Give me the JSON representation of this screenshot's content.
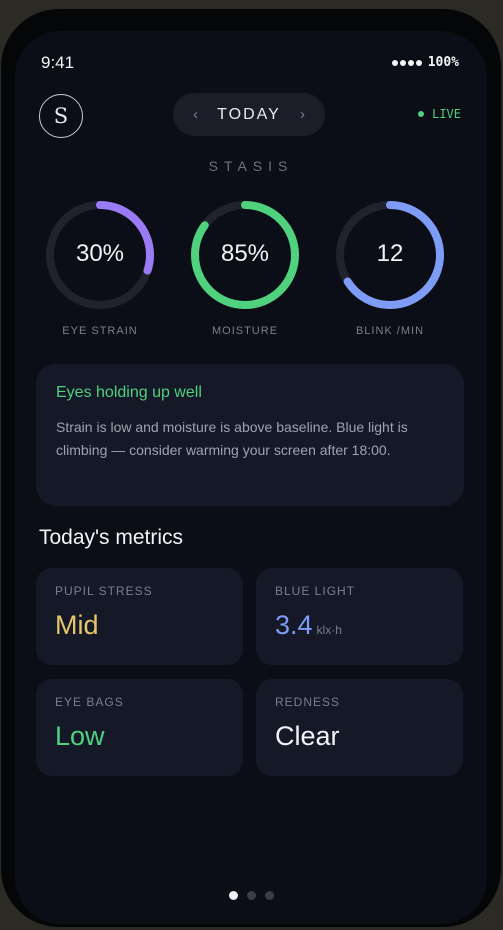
{
  "status": {
    "time": "9:41",
    "battery": "100%"
  },
  "header": {
    "logo": "S",
    "date_label": "TODAY",
    "prev": "‹",
    "next": "›",
    "live_label": "LIVE",
    "app_name": "STASIS"
  },
  "rings": [
    {
      "value_text": "30%",
      "label": "EYE STRAIN",
      "fraction": 0.3,
      "color": "#9a7bf6"
    },
    {
      "value_text": "85%",
      "label": "MOISTURE",
      "fraction": 0.85,
      "color": "#4fd17e"
    },
    {
      "value_text": "12",
      "label": "BLINK /MIN",
      "fraction": 0.66,
      "color": "#7e9cf5"
    }
  ],
  "insight": {
    "title": "Eyes holding up well",
    "body": "Strain is low and moisture is above baseline. Blue light is climbing — consider warming your screen after 18:00."
  },
  "metrics": {
    "title": "Today's metrics",
    "cards": [
      {
        "label": "PUPIL STRESS",
        "value": "Mid",
        "unit": "",
        "color": "#e6c66c"
      },
      {
        "label": "BLUE LIGHT",
        "value": "3.4",
        "unit": "klx·h",
        "color": "#7e9cf5"
      },
      {
        "label": "EYE BAGS",
        "value": "Low",
        "unit": "",
        "color": "#4fd17e"
      },
      {
        "label": "REDNESS",
        "value": "Clear",
        "unit": "",
        "color": "#f2f3f6"
      }
    ]
  },
  "pager": {
    "count": 3,
    "active": 0
  },
  "colors": {
    "ring_track": "#20232e",
    "accent_live": "#4fd17e",
    "background": "#0b0e16",
    "card": "#151826"
  }
}
